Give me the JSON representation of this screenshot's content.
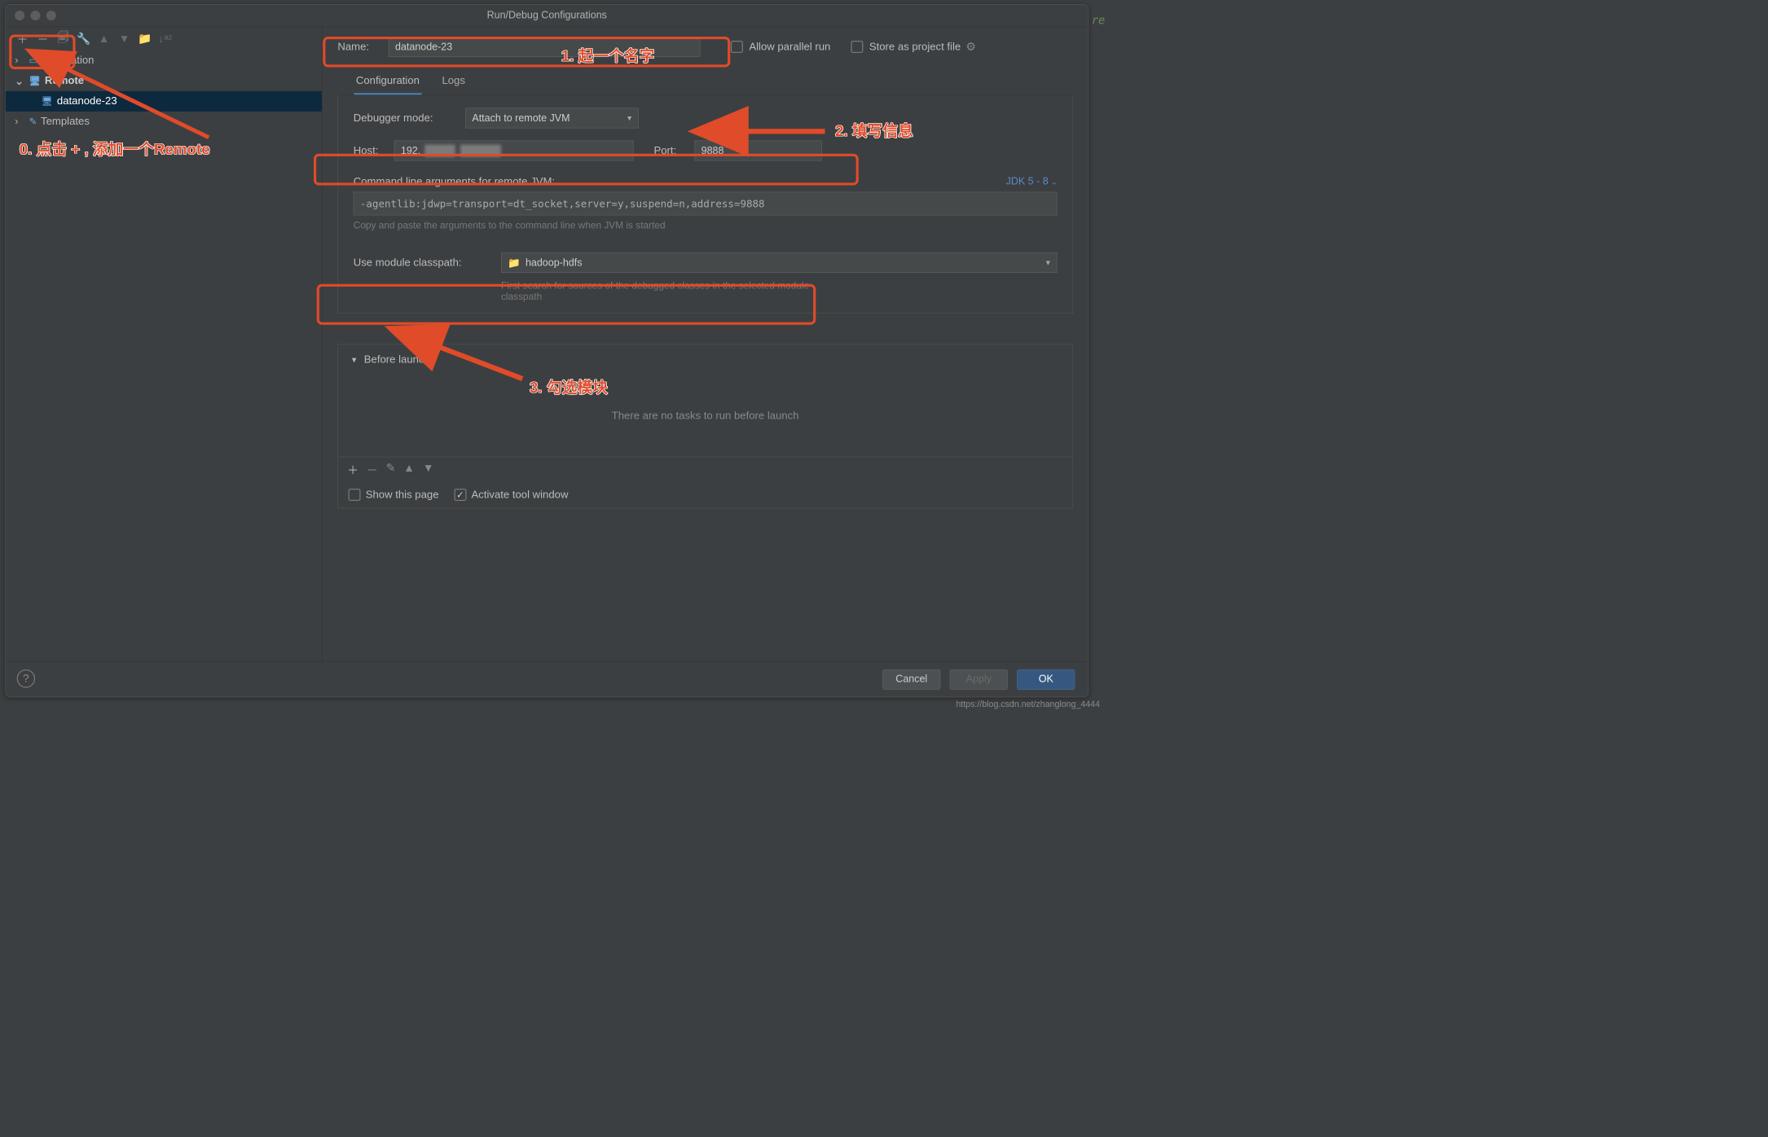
{
  "window": {
    "title": "Run/Debug Configurations"
  },
  "sidebar": {
    "items": [
      {
        "label": "Application"
      },
      {
        "label": "Remote"
      },
      {
        "label": "datanode-23"
      },
      {
        "label": "Templates"
      }
    ]
  },
  "form": {
    "nameLabel": "Name:",
    "name": "datanode-23",
    "allowParallel": "Allow parallel run",
    "storeAsProject": "Store as project file"
  },
  "tabs": {
    "config": "Configuration",
    "logs": "Logs"
  },
  "config": {
    "debuggerModeLabel": "Debugger mode:",
    "debuggerMode": "Attach to remote JVM",
    "hostLabel": "Host:",
    "host": "192.",
    "portLabel": "Port:",
    "port": "9888",
    "cliLabel": "Command line arguments for remote JVM:",
    "jdkLabel": "JDK 5 - 8",
    "cliValue": "-agentlib:jdwp=transport=dt_socket,server=y,suspend=n,address=9888",
    "cliHint": "Copy and paste the arguments to the command line when JVM is started",
    "moduleLabel": "Use module classpath:",
    "module": "hadoop-hdfs",
    "moduleHint": "First search for sources of the debugged classes in the selected module classpath"
  },
  "beforeLaunch": {
    "title": "Before launch",
    "empty": "There are no tasks to run before launch",
    "showPage": "Show this page",
    "activateTool": "Activate tool window"
  },
  "footer": {
    "cancel": "Cancel",
    "apply": "Apply",
    "ok": "OK"
  },
  "annotations": {
    "a0": "0. 点击 + , 添加一个Remote",
    "a1": "1. 起一个名字",
    "a2": "2. 填写信息",
    "a3": "3. 勾选模块"
  },
  "watermark": "https://blog.csdn.net/zhanglong_4444",
  "sidepanel_code": "re"
}
